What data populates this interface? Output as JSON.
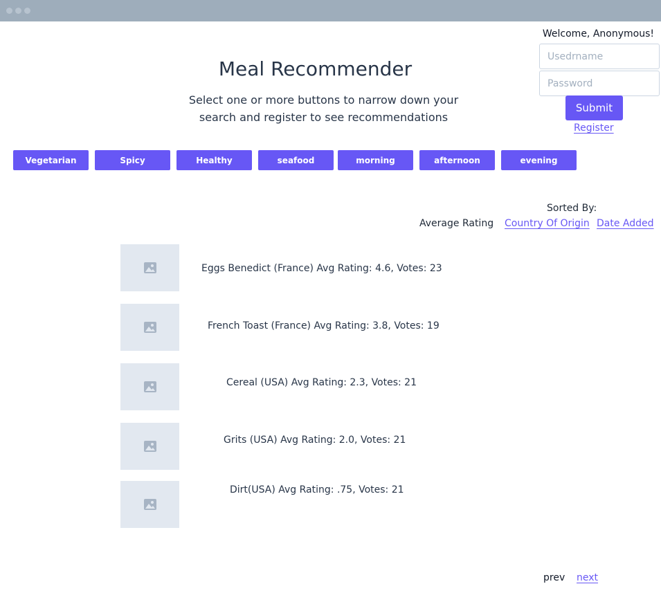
{
  "header": {
    "welcome": "Welcome, Anonymous!",
    "username_placeholder": "Usedrname",
    "password_placeholder": "Password",
    "submit_label": "Submit",
    "register_label": "Register"
  },
  "main": {
    "title": "Meal Recommender",
    "subtitle_line1": "Select one or more buttons to narrow down your",
    "subtitle_line2": "search and register to see recommendations"
  },
  "filters": [
    "Vegetarian",
    "Spicy",
    "Healthy",
    "seafood",
    "morning",
    "afternoon",
    "evening"
  ],
  "sort": {
    "heading": "Sorted By:",
    "options": [
      "Average Rating",
      "Country Of Origin",
      "Date Added"
    ]
  },
  "meals": [
    "Eggs Benedict (France) Avg Rating: 4.6, Votes: 23",
    "French Toast (France) Avg Rating: 3.8, Votes: 19",
    "Cereal (USA) Avg Rating: 2.3, Votes: 21",
    "Grits (USA) Avg Rating: 2.0, Votes: 21",
    "Dirt(USA) Avg Rating: .75, Votes: 21"
  ],
  "pagination": {
    "prev": "prev",
    "next": "next"
  },
  "colors": {
    "accent": "#6757f5",
    "browser_bar": "#9eadbb",
    "thumb_placeholder": "#e2e8f0"
  },
  "icons": {
    "meal_thumbnail": "image-placeholder-icon"
  }
}
